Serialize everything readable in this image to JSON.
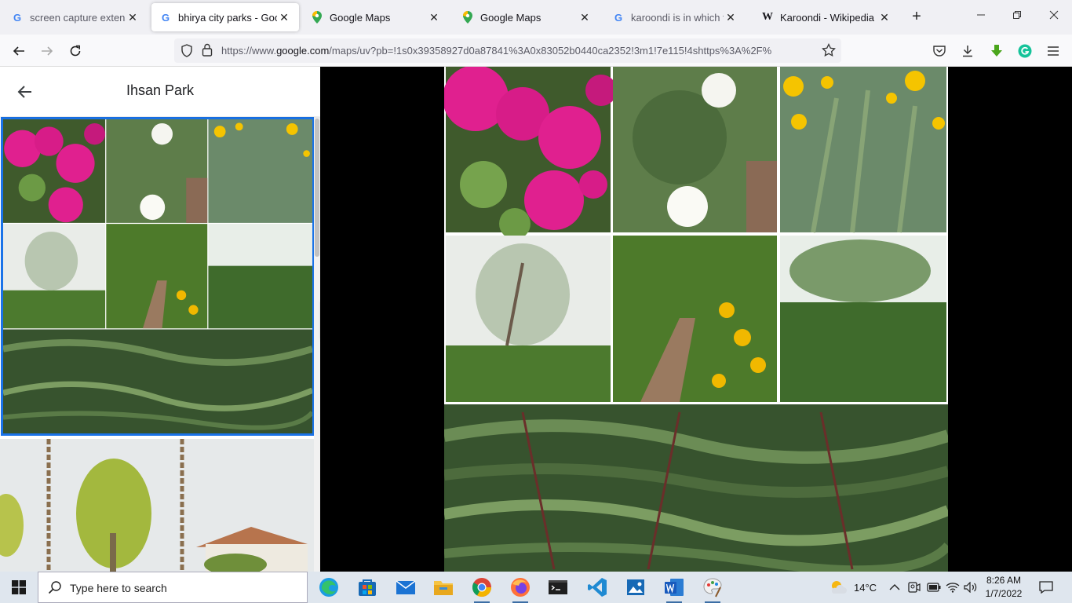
{
  "browser": {
    "tabs": [
      {
        "title": "screen capture extension",
        "icon": "google-g-icon"
      },
      {
        "title": "bhirya city parks - Google",
        "icon": "google-g-icon",
        "active": true
      },
      {
        "title": "Google Maps",
        "icon": "maps-pin-icon"
      },
      {
        "title": "Google Maps",
        "icon": "maps-pin-icon"
      },
      {
        "title": "karoondi is in which tehsi",
        "icon": "google-g-icon"
      },
      {
        "title": "Karoondi - Wikipedia",
        "icon": "wikipedia-w-icon"
      }
    ],
    "close_glyph": "✕",
    "new_tab_glyph": "+",
    "url_prefix": "https://www.",
    "url_domain": "google.com",
    "url_rest": "/maps/uv?pb=!1s0x39358927d0a87841%3A0x83052b0440ca2352!3m1!7e115!4shttps%3A%2F%"
  },
  "panel": {
    "title": "Ihsan Park"
  },
  "taskbar": {
    "search_placeholder": "Type here to search",
    "weather": "14°C",
    "time": "8:26 AM",
    "date": "1/7/2022"
  },
  "colors": {
    "accent": "#1a73e8",
    "bougainvillea": "#e0208f",
    "marigold": "#f5c400",
    "foliage": "#4f7a3e"
  }
}
